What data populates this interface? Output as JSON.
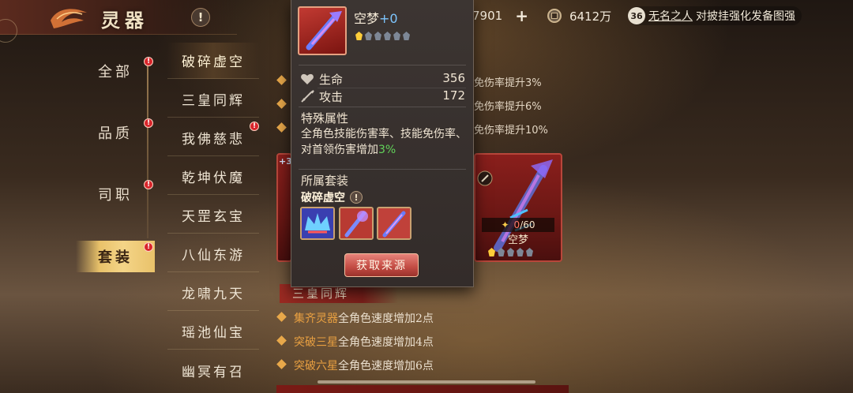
{
  "header": {
    "title": "灵器",
    "info_icon": "!"
  },
  "resources": {
    "value_1": "7901",
    "plus": "+",
    "coins": "6412万"
  },
  "marquee": {
    "level": "36",
    "player": "无名之人",
    "message": "对披挂强化发备图强"
  },
  "categories": [
    {
      "label": "全部",
      "badge": "!"
    },
    {
      "label": "品质",
      "badge": "!"
    },
    {
      "label": "司职",
      "badge": "!"
    },
    {
      "label": "套装",
      "badge": "!",
      "active": true
    }
  ],
  "sets": [
    {
      "label": "破碎虚空",
      "active": true
    },
    {
      "label": "三皇同辉"
    },
    {
      "label": "我佛慈悲",
      "badge": "!"
    },
    {
      "label": "乾坤伏魔"
    },
    {
      "label": "天罡玄宝"
    },
    {
      "label": "八仙东游"
    },
    {
      "label": "龙啸九天"
    },
    {
      "label": "瑶池仙宝"
    },
    {
      "label": "幽冥有召"
    }
  ],
  "bonus_lines": [
    "免伤率提升3%",
    "免伤率提升6%",
    "免伤率提升10%"
  ],
  "card": {
    "progress": "0/60",
    "progress_current": "0",
    "progress_total": "/60",
    "name": "空梦",
    "stars_lit": 1,
    "stars_total": 5,
    "left_plus": "+3"
  },
  "section": {
    "title": "三皇同辉",
    "rows": [
      {
        "cond": "集齐灵器",
        "effect": "全角色速度增加2点"
      },
      {
        "cond": "突破三星",
        "effect": "全角色速度增加4点"
      },
      {
        "cond": "突破六星",
        "effect": "全角色速度增加6点"
      }
    ]
  },
  "popup": {
    "name": "空梦",
    "plus": "+0",
    "stars_lit": 1,
    "stars_total": 6,
    "stats": [
      {
        "label": "生命",
        "value": "356",
        "icon": "heart-icon"
      },
      {
        "label": "攻击",
        "value": "172",
        "icon": "sword-icon"
      }
    ],
    "special_title": "特殊属性",
    "special_desc": "全角色技能伤害率、技能免伤率、对首领伤害增加",
    "special_value": "3%",
    "set_title": "所属套装",
    "set_name": "破碎虚空",
    "set_info": "!",
    "source_button": "获取来源"
  },
  "colors": {
    "accent_gold": "#e9c26a",
    "badge_red": "#d8252b",
    "card_red": "#8a1f1c",
    "green_value": "#62d35a",
    "plus_blue": "#7ec6ff"
  }
}
